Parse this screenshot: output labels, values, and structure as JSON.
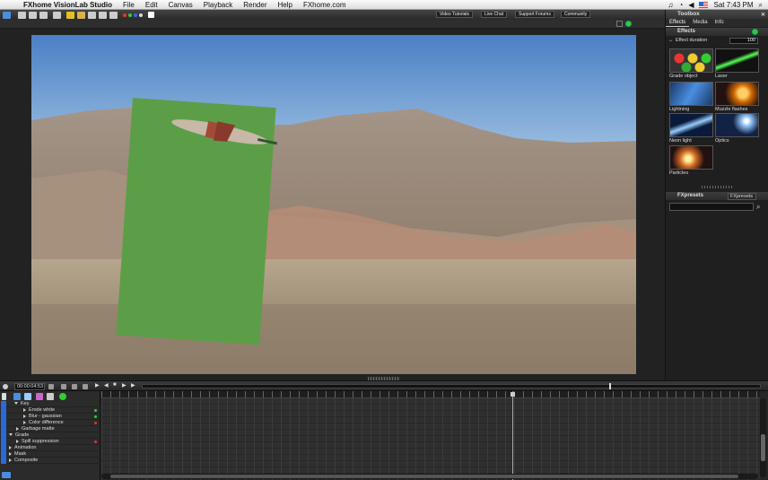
{
  "menubar": {
    "apple": "",
    "app_name": "FXhome VisionLab Studio",
    "items": [
      "File",
      "Edit",
      "Canvas",
      "Playback",
      "Render",
      "Help",
      "FXhome.com"
    ],
    "clock": "Sat 7:43 PM"
  },
  "toolbar": {
    "buttons": [
      "Video Tutorials",
      "Live Chat",
      "Support Forums",
      "Community"
    ]
  },
  "timeline": {
    "timecode": "00:00:04:53",
    "tracks": [
      {
        "label": "Key",
        "level": 1,
        "expanded": true,
        "led": ""
      },
      {
        "label": "Erode white",
        "level": 2,
        "expanded": false,
        "led": "#3c3"
      },
      {
        "label": "Blur - gaussian",
        "level": 2,
        "expanded": false,
        "led": "#3c3"
      },
      {
        "label": "Color difference",
        "level": 2,
        "expanded": false,
        "led": "#d33"
      },
      {
        "label": "Garbage matte",
        "level": 2,
        "expanded": false,
        "led": ""
      },
      {
        "label": "Grade",
        "level": 1,
        "expanded": true,
        "led": ""
      },
      {
        "label": "Spill suppression",
        "level": 2,
        "expanded": false,
        "led": "#d33"
      },
      {
        "label": "Animation",
        "level": 1,
        "expanded": false,
        "led": ""
      },
      {
        "label": "Mask",
        "level": 1,
        "expanded": false,
        "led": ""
      },
      {
        "label": "Composite",
        "level": 1,
        "expanded": false,
        "led": ""
      }
    ]
  },
  "toolbox": {
    "title": "Toolbox",
    "tabs": [
      "Effects",
      "Media",
      "Info"
    ],
    "effects_header": "Effects",
    "effect_duration_label": "Effect duration",
    "effect_duration_value": "100",
    "effects": [
      {
        "label": "Grade object",
        "icon": "grade-object-thumb"
      },
      {
        "label": "Laser",
        "icon": "laser-thumb"
      },
      {
        "label": "Lightning",
        "icon": "lightning-thumb"
      },
      {
        "label": "Muzzle flashes",
        "icon": "muzzle-flashes-thumb"
      },
      {
        "label": "Neon light",
        "icon": "neon-light-thumb"
      },
      {
        "label": "Optics",
        "icon": "optics-thumb"
      },
      {
        "label": "Particles",
        "icon": "particles-thumb"
      }
    ],
    "fxpresets_header": "FXpresets",
    "fxpresets_chooser": "FXpresets"
  },
  "colors": {
    "accent_green": "#3c3",
    "chroma_green": "#5c9e47",
    "sky_blue": "#4f84c7"
  }
}
